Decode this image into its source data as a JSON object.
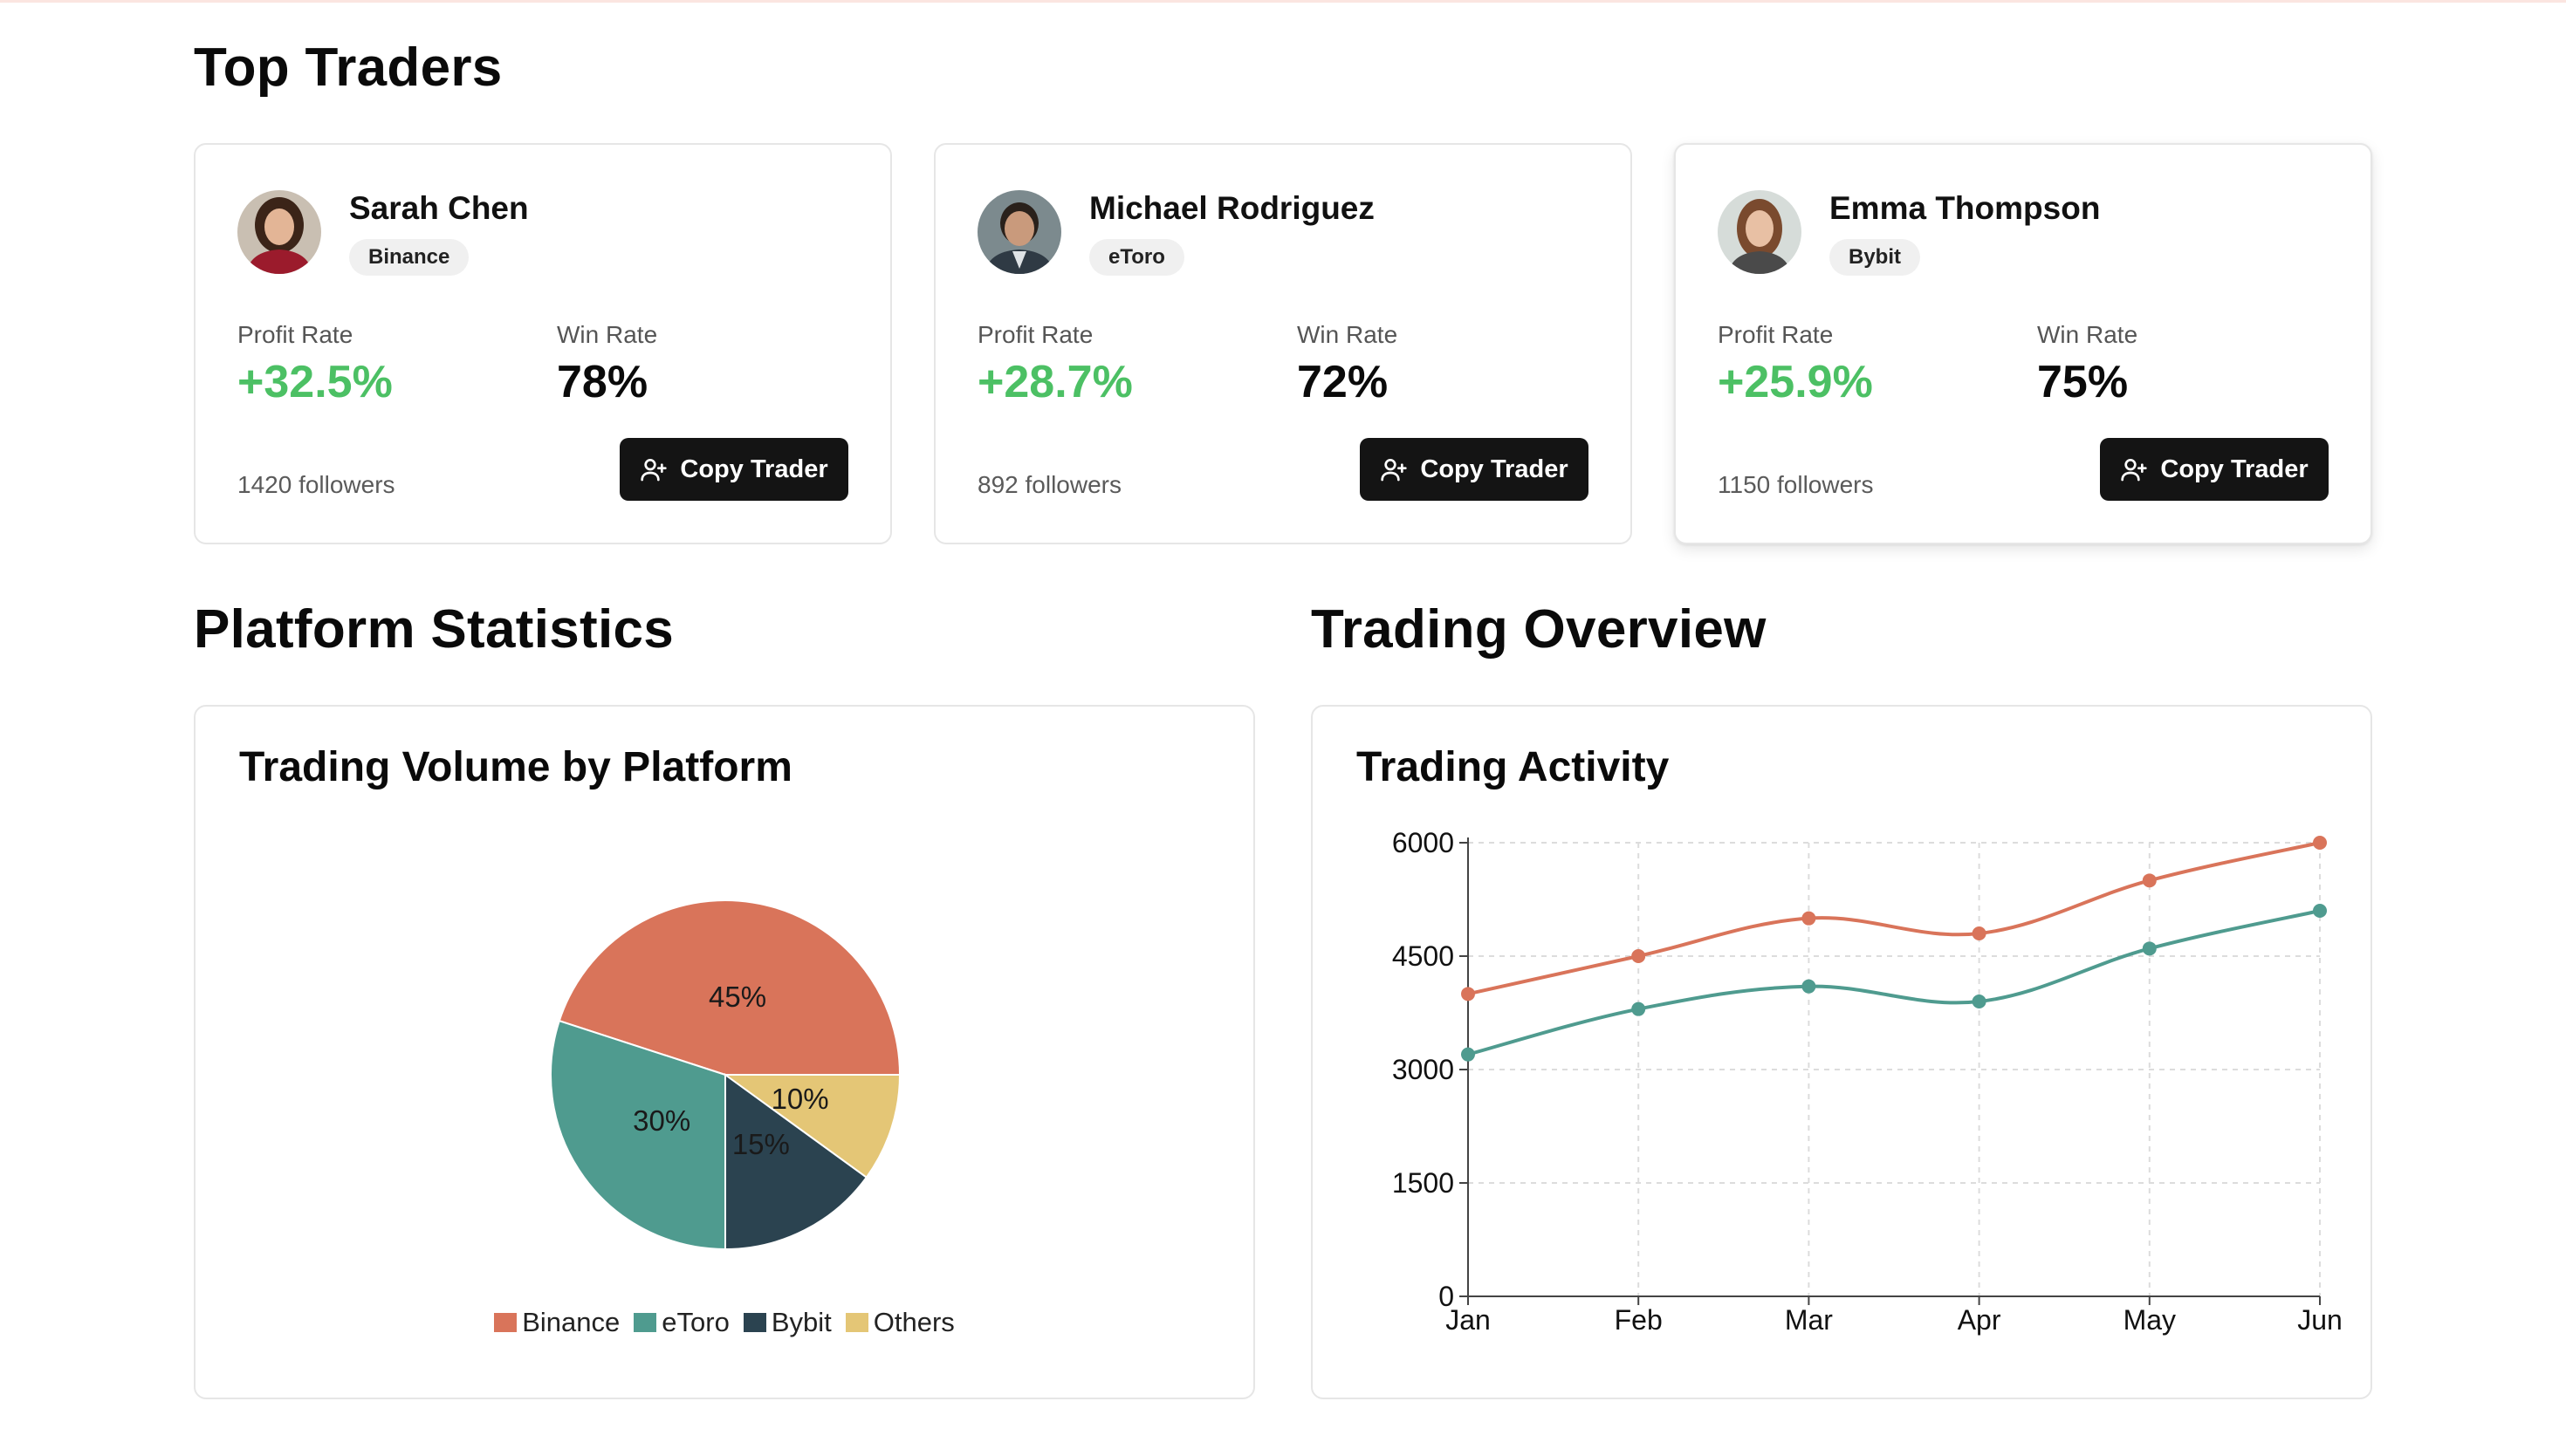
{
  "top_traders": {
    "heading": "Top Traders",
    "profit_label": "Profit Rate",
    "win_label": "Win Rate",
    "copy_label": "Copy Trader",
    "traders": [
      {
        "name": "Sarah Chen",
        "platform": "Binance",
        "profit": "+32.5%",
        "win": "78%",
        "followers": "1420 followers"
      },
      {
        "name": "Michael Rodriguez",
        "platform": "eToro",
        "profit": "+28.7%",
        "win": "72%",
        "followers": "892 followers"
      },
      {
        "name": "Emma Thompson",
        "platform": "Bybit",
        "profit": "+25.9%",
        "win": "75%",
        "followers": "1150 followers"
      }
    ]
  },
  "platform_statistics": {
    "heading": "Platform Statistics",
    "card_title": "Trading Volume by Platform"
  },
  "trading_overview": {
    "heading": "Trading Overview",
    "card_title": "Trading Activity"
  },
  "colors": {
    "binance": "#d9745a",
    "etoro": "#4f9b8f",
    "bybit": "#2b4350",
    "others": "#e4c676",
    "line_orange": "#d9745a",
    "line_teal": "#4f9b8f",
    "profit_green": "#4cc064"
  },
  "icons": {
    "copy_button": "user-plus-icon"
  },
  "chart_data": [
    {
      "type": "pie",
      "title": "Trading Volume by Platform",
      "categories": [
        "Binance",
        "eToro",
        "Bybit",
        "Others"
      ],
      "values": [
        45,
        30,
        15,
        10
      ],
      "labels": [
        "45%",
        "30%",
        "15%",
        "10%"
      ],
      "legend": "bottom"
    },
    {
      "type": "line",
      "title": "Trading Activity",
      "x": [
        "Jan",
        "Feb",
        "Mar",
        "Apr",
        "May",
        "Jun"
      ],
      "ylim": [
        0,
        6000
      ],
      "yticks": [
        0,
        1500,
        3000,
        4500,
        6000
      ],
      "grid": true,
      "series": [
        {
          "values": [
            4000,
            4500,
            5000,
            4800,
            5500,
            6000
          ]
        },
        {
          "values": [
            3200,
            3800,
            4100,
            3900,
            4600,
            5100
          ]
        }
      ]
    }
  ]
}
